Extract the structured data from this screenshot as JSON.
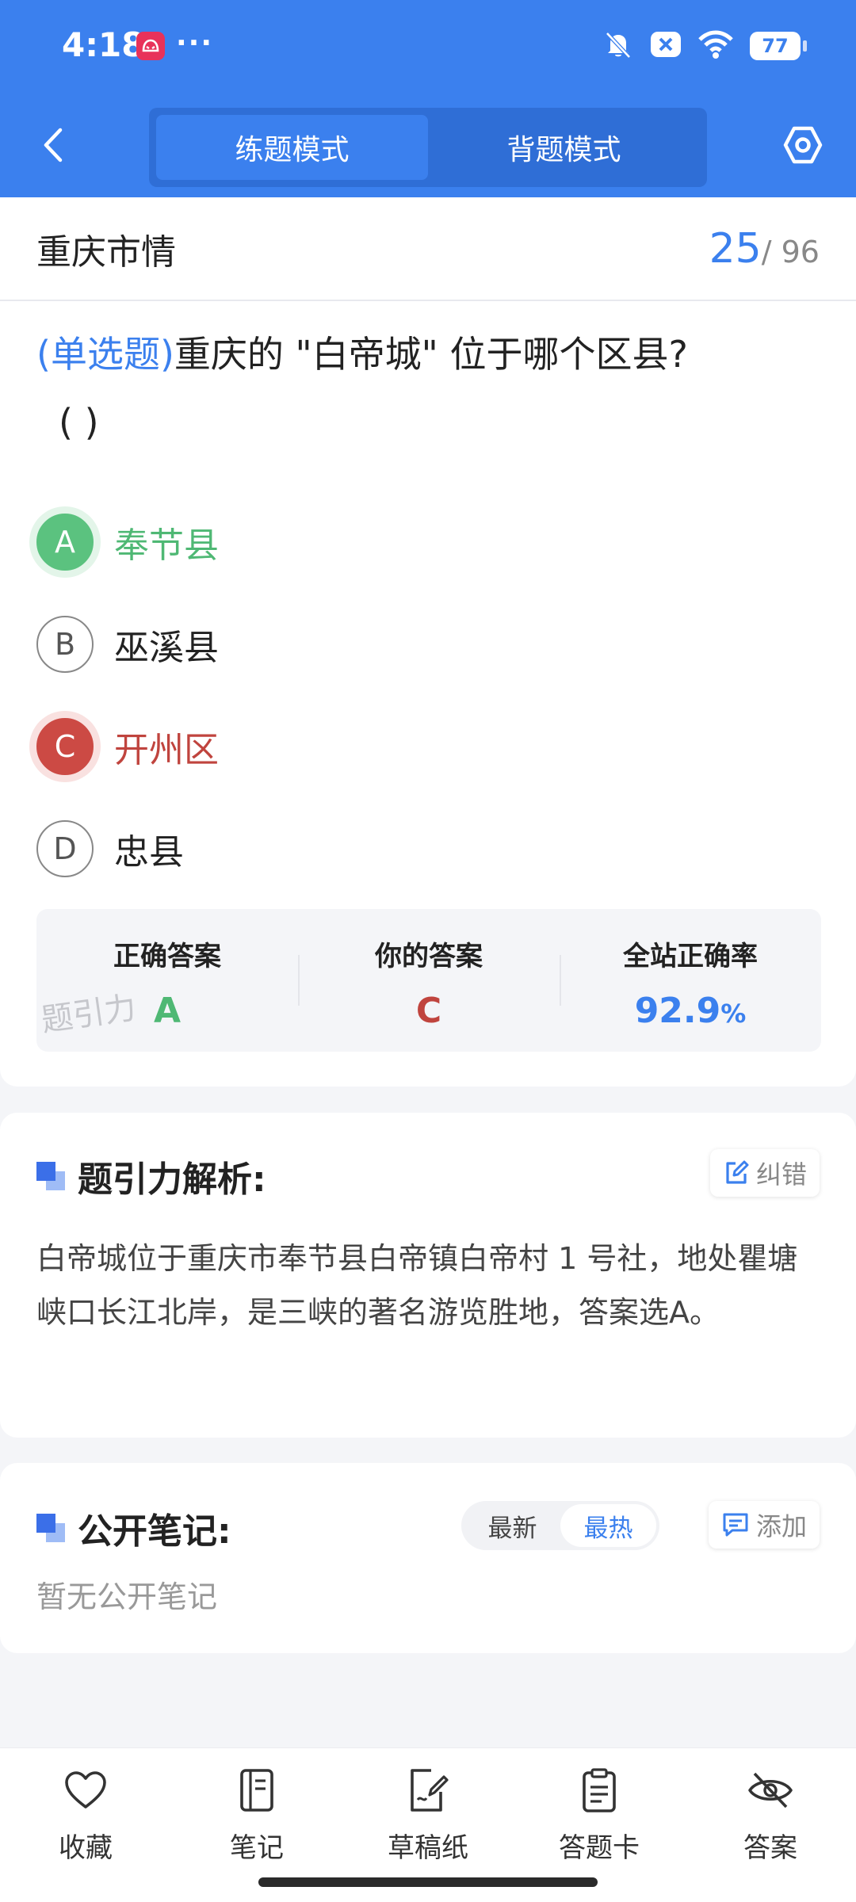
{
  "status_bar": {
    "time": "4:18",
    "more": "···",
    "battery": "77"
  },
  "nav": {
    "modes": [
      "练题模式",
      "背题模式"
    ],
    "active_mode": 0
  },
  "subject": {
    "title": "重庆市情",
    "current": "25",
    "total": "/ 96"
  },
  "question": {
    "type": "(单选题)",
    "text": "重庆的 \"白帝城\" 位于哪个区县?",
    "blank": "(        )"
  },
  "options": [
    {
      "letter": "A",
      "text": "奉节县",
      "state": "correct"
    },
    {
      "letter": "B",
      "text": "巫溪县",
      "state": "normal"
    },
    {
      "letter": "C",
      "text": "开州区",
      "state": "wrong"
    },
    {
      "letter": "D",
      "text": "忠县",
      "state": "normal"
    }
  ],
  "stats": {
    "correct_label": "正确答案",
    "correct_value": "A",
    "yours_label": "你的答案",
    "yours_value": "C",
    "rate_label": "全站正确率",
    "rate_value": "92.9",
    "rate_unit": "%",
    "watermark": "题引力"
  },
  "analysis": {
    "title": "题引力解析:",
    "report_label": "纠错",
    "text": "白帝城位于重庆市奉节县白帝镇白帝村 1 号社，地处瞿塘峡口长江北岸，是三峡的著名游览胜地，答案选A。"
  },
  "notes": {
    "title": "公开笔记:",
    "sort": [
      "最新",
      "最热"
    ],
    "active_sort": 1,
    "add_label": "添加",
    "empty_text": "暂无公开笔记"
  },
  "toolbar": {
    "items": [
      "收藏",
      "笔记",
      "草稿纸",
      "答题卡",
      "答案"
    ]
  },
  "colors": {
    "primary": "#3b80ee",
    "correct": "#5bc27f",
    "wrong": "#cc4a44"
  }
}
